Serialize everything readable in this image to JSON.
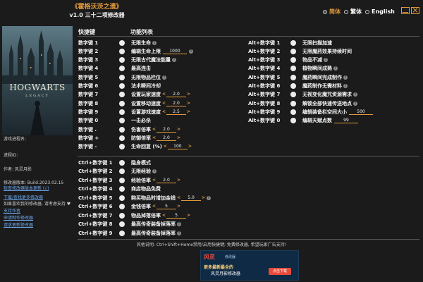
{
  "header": {
    "game_title": "《霍格沃茨之遗》",
    "trainer_title": "v1.0 三十二项修改器",
    "languages": [
      {
        "label": "简体",
        "selected": true
      },
      {
        "label": "繁体",
        "selected": false
      },
      {
        "label": "English",
        "selected": false
      }
    ]
  },
  "cover": {
    "logo": "HOGWARTS",
    "logo_sub": "LEGACY"
  },
  "left_panel": {
    "process_label": "游戏进程名:",
    "process_id_label": "进程ID:",
    "author": "作者: 风灵月影",
    "version": "修改器版本: Build.2023.02.15",
    "check_update": "检查修改器版本更新 (√)",
    "download_link": "下载/查找更多修改器",
    "support_note": "如果喜欢我的修改器, 请考虑支持 ♥",
    "support_link": "支持作者",
    "request_link": "申请制作修改器",
    "request_update_link": "请求更新修改器"
  },
  "table": {
    "col_hotkey": "快捷键",
    "col_function": "功能列表"
  },
  "left_rows": [
    {
      "key": "数字键 1",
      "label": "无限生命",
      "info": true
    },
    {
      "key": "数字键 2",
      "label": "编辑生命上限",
      "value": "1000",
      "info": true
    },
    {
      "key": "数字键 3",
      "label": "无限古代魔法能量",
      "info": true
    },
    {
      "key": "数字键 4",
      "label": "最高连击"
    },
    {
      "key": "数字键 5",
      "label": "无限物品栏位",
      "info": true
    },
    {
      "key": "数字键 6",
      "label": "法术瞬间冷却"
    },
    {
      "key": "数字键 7",
      "label": "设置玩家速度",
      "value": "2.0",
      "spin": true
    },
    {
      "key": "数字键 8",
      "label": "设置移动速度",
      "value": "2.0",
      "spin": true
    },
    {
      "key": "数字键 9",
      "label": "设置游戏速度",
      "value": "2.5",
      "spin": true
    },
    {
      "key": "数字键 0",
      "label": "一击必杀"
    },
    {
      "key": "数字键 .",
      "label": "伤害倍率",
      "value": "2.0",
      "spin": true
    },
    {
      "key": "数字键 +",
      "label": "防御倍率",
      "value": "2.0",
      "spin": true
    },
    {
      "key": "数字键 -",
      "label": "生命回复 (%)",
      "value": "100",
      "spin": true
    }
  ],
  "right_rows": [
    {
      "key": "Alt+数字键 1",
      "label": "无限扫描加速"
    },
    {
      "key": "Alt+数字键 2",
      "label": "无限魔药效果持续时间"
    },
    {
      "key": "Alt+数字键 3",
      "label": "物品不减",
      "info": true
    },
    {
      "key": "Alt+数字键 4",
      "label": "植物瞬间成熟",
      "info": true
    },
    {
      "key": "Alt+数字键 5",
      "label": "魔药瞬间完成制作",
      "info": true
    },
    {
      "key": "Alt+数字键 6",
      "label": "魔药制作无需材料",
      "info": true
    },
    {
      "key": "Alt+数字键 7",
      "label": "无视变化魔咒资源需求",
      "info": true
    },
    {
      "key": "Alt+数字键 8",
      "label": "解锁全部快速传送地点",
      "info": true
    },
    {
      "key": "Alt+数字键 9",
      "label": "编辑装备栏空间大小",
      "value": "500"
    },
    {
      "key": "Alt+数字键 0",
      "label": "编辑天赋点数",
      "value": "99"
    }
  ],
  "ctrl_rows": [
    {
      "key": "Ctrl+数字键 1",
      "label": "隐身模式"
    },
    {
      "key": "Ctrl+数字键 2",
      "label": "无限经验",
      "info": true
    },
    {
      "key": "Ctrl+数字键 3",
      "label": "经验倍率",
      "value": "2.0",
      "spin": true
    },
    {
      "key": "Ctrl+数字键 4",
      "label": "商店物品免费"
    },
    {
      "key": "Ctrl+数字键 5",
      "label": "购买物品时增加金钱",
      "value": "5.0",
      "spin": true,
      "info": true
    },
    {
      "key": "Ctrl+数字键 6",
      "label": "金钱倍率",
      "value": "5",
      "spin": true
    },
    {
      "key": "Ctrl+数字键 7",
      "label": "物品掉落倍率",
      "value": "5",
      "spin": true
    },
    {
      "key": "Ctrl+数字键 8",
      "label": "最高传奇装备掉落率",
      "info": true
    },
    {
      "key": "Ctrl+数字键 9",
      "label": "最高传奇装备掉落率",
      "info": true
    }
  ],
  "footer": {
    "note": "其他说明: Ctrl+Shift+Home禁用/启用快捷键; 免费修改器, 希望玩家广告支持!",
    "ad_brand": "风灵",
    "ad_brand_sub": "修改器",
    "ad_line1": "更多最新最全的",
    "ad_line2": "风灵月影修改器",
    "ad_button": "点击下载"
  },
  "colors": {
    "accent": "#e29a3a",
    "background": "#1b1b1b",
    "text": "#f2f2f2",
    "link": "#6ea8f0"
  }
}
